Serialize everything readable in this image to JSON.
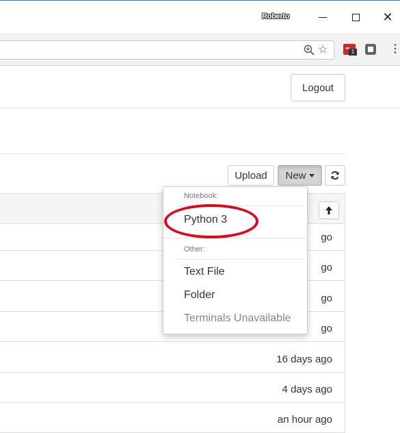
{
  "window": {
    "user": "Roberto",
    "minimize_glyph": "",
    "close_glyph": "✕"
  },
  "toolbar": {
    "zoom_icon": "zoom-magnifier-icon",
    "star_glyph": "☆",
    "extension_badge": "1",
    "menu_glyph": "⋮"
  },
  "header": {
    "logout_label": "Logout"
  },
  "actions": {
    "upload_label": "Upload",
    "new_label": "New",
    "refresh_glyph": "⟳"
  },
  "list": {
    "sort_glyph": "↑",
    "rows": [
      {
        "modified": "go"
      },
      {
        "modified": "go"
      },
      {
        "modified": "go"
      },
      {
        "modified": "go"
      },
      {
        "modified": "16 days ago"
      },
      {
        "modified": "4 days ago"
      },
      {
        "modified": "an hour ago"
      }
    ]
  },
  "new_menu": {
    "notebook_header": "Notebook:",
    "python_label": "Python 3",
    "other_header": "Other:",
    "text_file_label": "Text File",
    "folder_label": "Folder",
    "terminals_label": "Terminals Unavailable"
  },
  "colors": {
    "highlight": "#e2061a",
    "window_accent": "#2b7ad0",
    "lastpass": "#cc2b2b"
  }
}
